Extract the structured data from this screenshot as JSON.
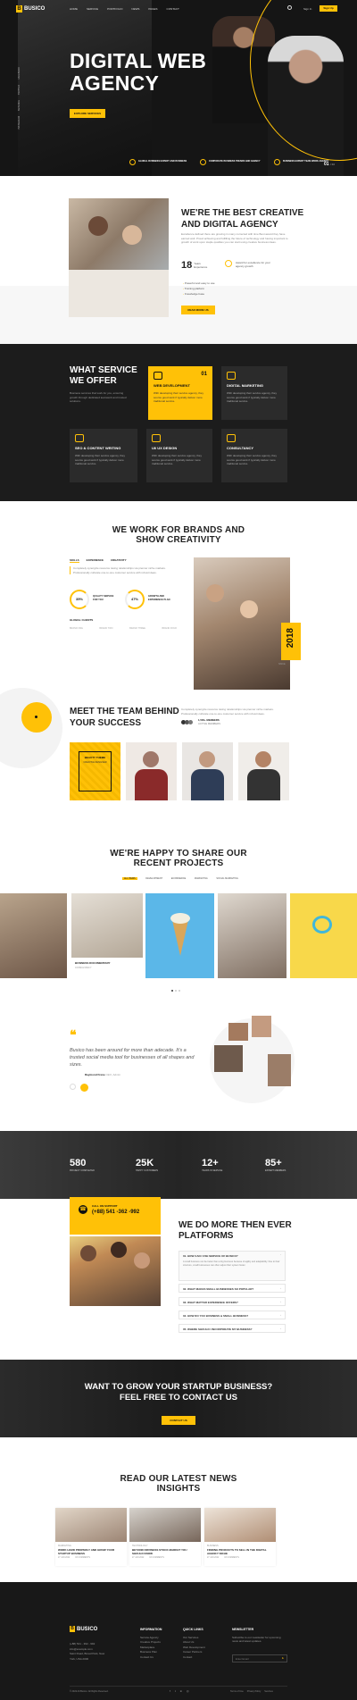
{
  "brand": {
    "logo_text": "BUSICO",
    "accent": "#ffc107",
    "dark": "#1c1c1c"
  },
  "nav": {
    "items": [
      "HOME",
      "SERVICE",
      "PORTFOLIO",
      "NEWS",
      "PAGES",
      "CONTACT"
    ],
    "login": "Sign In",
    "cta": "Sign Up"
  },
  "hero": {
    "title_line1": "DIGITAL WEB",
    "title_line2": "AGENCY",
    "button": "EXPLORE SERVICES",
    "social": [
      "FACEBOOK",
      "TWITTER",
      "BEHANCE",
      "INSTAGRAM"
    ],
    "features": [
      "GLOBAL BUSINESS EXPERT AND BUSINESS",
      "CORPORATE BUSINESS TRENDS AND AGENCY",
      "BUSINESS EXPERT TEAM WORK AGENCY"
    ],
    "slide": "01",
    "slide_total": "/ 03"
  },
  "about": {
    "title_line1": "WE'RE THE BEST CREATIVE",
    "title_line2": "AND DIGITAL AGENCY",
    "desc": "Excellence defined there are growing in many corrected with time Best award they have earned well. Proud achieving and fulfilling the future of technology and having important to growth of work upon staple qualities you can start using creative business ideas.",
    "years": "18",
    "years_label": "Years Experience",
    "award_label": "Award for excellence for your agency growth",
    "list": [
      "Powerful and easy to use",
      "Training platform",
      "Knowledge base"
    ],
    "button": "READ MORE US"
  },
  "services": {
    "title_line1": "WHAT SERVICE",
    "title_line2": "WE OFFER",
    "intro": "Business services that work for you, ensuring growth through dedicated teamwork and trusted solutions.",
    "cards": [
      {
        "title": "WEB DEVELOPMENT",
        "num": "01",
        "desc": "With developing their service agency, they source good work if typically deliver more traditional service."
      },
      {
        "title": "DIGITAL MARKETING",
        "desc": "With developing their service agency, they source good work if typically deliver more traditional service."
      },
      {
        "title": "SEO & CONTENT WRITING",
        "desc": "With developing their service agency, they source good work if typically deliver more traditional service."
      },
      {
        "title": "UI/ UX DESIGN",
        "desc": "With developing their service agency, they source good work if typically deliver more traditional service."
      },
      {
        "title": "CONSULTANCY",
        "desc": "With developing their service agency, they source good work if typically deliver more traditional service."
      }
    ]
  },
  "brands": {
    "title_line1": "WE WORK FOR BRANDS AND",
    "title_line2": "SHOW CREATIVITY",
    "tabs": [
      "SKILLS",
      "EXPERIENCE",
      "CREATIVITY"
    ],
    "desc": "Completely synergize resource taxing relationships via premier niche markets. Professionally cultivate one-to-one customer service with robust ideas.",
    "stats": [
      {
        "pct": "35%",
        "label": "QUALITY SERVICE FOR YOU"
      },
      {
        "pct": "47%",
        "label": "GROWTH AND EXPERIENCE PLAN"
      }
    ],
    "clients_label": "GLOBAL CLIENTS",
    "clients": [
      "BRAND ONE",
      "BRAND TWO",
      "BRAND THREE",
      "BRAND FOUR"
    ],
    "year": "2018",
    "since": "SINCE"
  },
  "team": {
    "title_line1": "MEET THE TEAM BEHIND",
    "title_line2": "YOUR SUCCESS",
    "desc": "Completely synergize resource taxing relationships via premier niche markets. Professionally cultivate one-to-one customer service with robust ideas.",
    "members_label": "1,500+ MEMBERS",
    "members_sub": "ACTIVE MEMBERS",
    "card_title": "BEAUTY THEME",
    "card_sub": "CREATIVE DESIGNER"
  },
  "projects": {
    "title_line1": "WE'RE HAPPY TO SHARE OUR",
    "title_line2": "RECENT PROJECTS",
    "filters": [
      "ALL ITEMS",
      "DEVELOPMENT",
      "ECOMMERCE",
      "MARKETING",
      "SOCIAL MARKETING"
    ],
    "caption_title": "BUSINESS DOCUMENTARY",
    "caption_sub": "CONSULTANCY"
  },
  "testimonial": {
    "quote": "Busico has been around for more than adecade. It's a trusted social media tool for businesses of all shapes and sizes.",
    "author": "Raymond Frene",
    "role": "CEO, Admin"
  },
  "counters": [
    {
      "num": "580",
      "label": "PROJECT COMPLETED"
    },
    {
      "num": "25K",
      "label": "HAPPY CUSTOMERS"
    },
    {
      "num": "12+",
      "label": "YEARS IN SERVICE"
    },
    {
      "num": "85+",
      "label": "EXPERT MEMBERS"
    }
  ],
  "platforms": {
    "call_label": "CALL ON SUPPORT",
    "phone": "(+88) 541 -362 -992",
    "title_line1": "WE DO MORE THEN EVER",
    "title_line2": "PLATFORMS",
    "faq": [
      {
        "q": "01. HOW CAN I USE SERVICE OF BUSICO?",
        "a": "A small business can be better than a big business because of agility and adaptability. Due to their structure, small businesses can often adjust their system faster."
      },
      {
        "q": "02. WHAT MAKES SMALL BUSINESSES SO POPULAR?"
      },
      {
        "q": "03. WHAT MATTER EXPERIENCE OFFERS?"
      },
      {
        "q": "04. HOW DO YOU BUSINESS & SMALL BUSINESS?"
      },
      {
        "q": "05. WHERE SHOULD I INCORPORATE MY BUSINESS?"
      }
    ]
  },
  "contact_cta": {
    "title_line1": "WANT TO GROW YOUR STARTUP BUSINESS?",
    "title_line2": "FEEL FREE TO CONTACT US",
    "button": "CONTACT US"
  },
  "news": {
    "title_line1": "READ OUR LATEST NEWS",
    "title_line2": "INSIGHTS",
    "items": [
      {
        "cat": "MARKETING",
        "title": "WORK HARD PROPERLY AND GROW YOUR STARTUP BUSINESS",
        "date": "27 JAN 2022",
        "comments": "03 COMMENTS"
      },
      {
        "cat": "TECHNOLOGY",
        "title": "BEYOND DIFFINESS STOCK MARKET YOU SHOULD KNOW",
        "date": "27 JAN 2022",
        "comments": "03 COMMENTS"
      },
      {
        "cat": "BUSINESS",
        "title": "FINDING PRODUCTS TO SELL IN THE DIGITAL AGENCY NICHE",
        "date": "27 JAN 2022",
        "comments": "03 COMMENTS"
      }
    ]
  },
  "footer": {
    "contact": [
      "(+88) 541 - 362 - 992",
      "info@example.com",
      "Saint Road, Broad Park, New York, USA 2000"
    ],
    "col1_title": "INFORMATION",
    "col1": [
      "Service Agency",
      "Creative Projects",
      "Marketplace",
      "Business Plan",
      "Contact Us"
    ],
    "col2_title": "QUICK LINKS",
    "col2": [
      "Our Services",
      "About Us",
      "Web Development",
      "Career Partners",
      "Contact"
    ],
    "col3_title": "NEWSLETTER",
    "newsletter_desc": "Subscribe to our newsletter for upcoming news and latest updates.",
    "email_placeholder": "Enter Email",
    "copyright": "© 2022 All Busico. All Rights Reserved.",
    "legal": [
      "Terms of Use",
      "Privacy Policy",
      "Services"
    ]
  }
}
